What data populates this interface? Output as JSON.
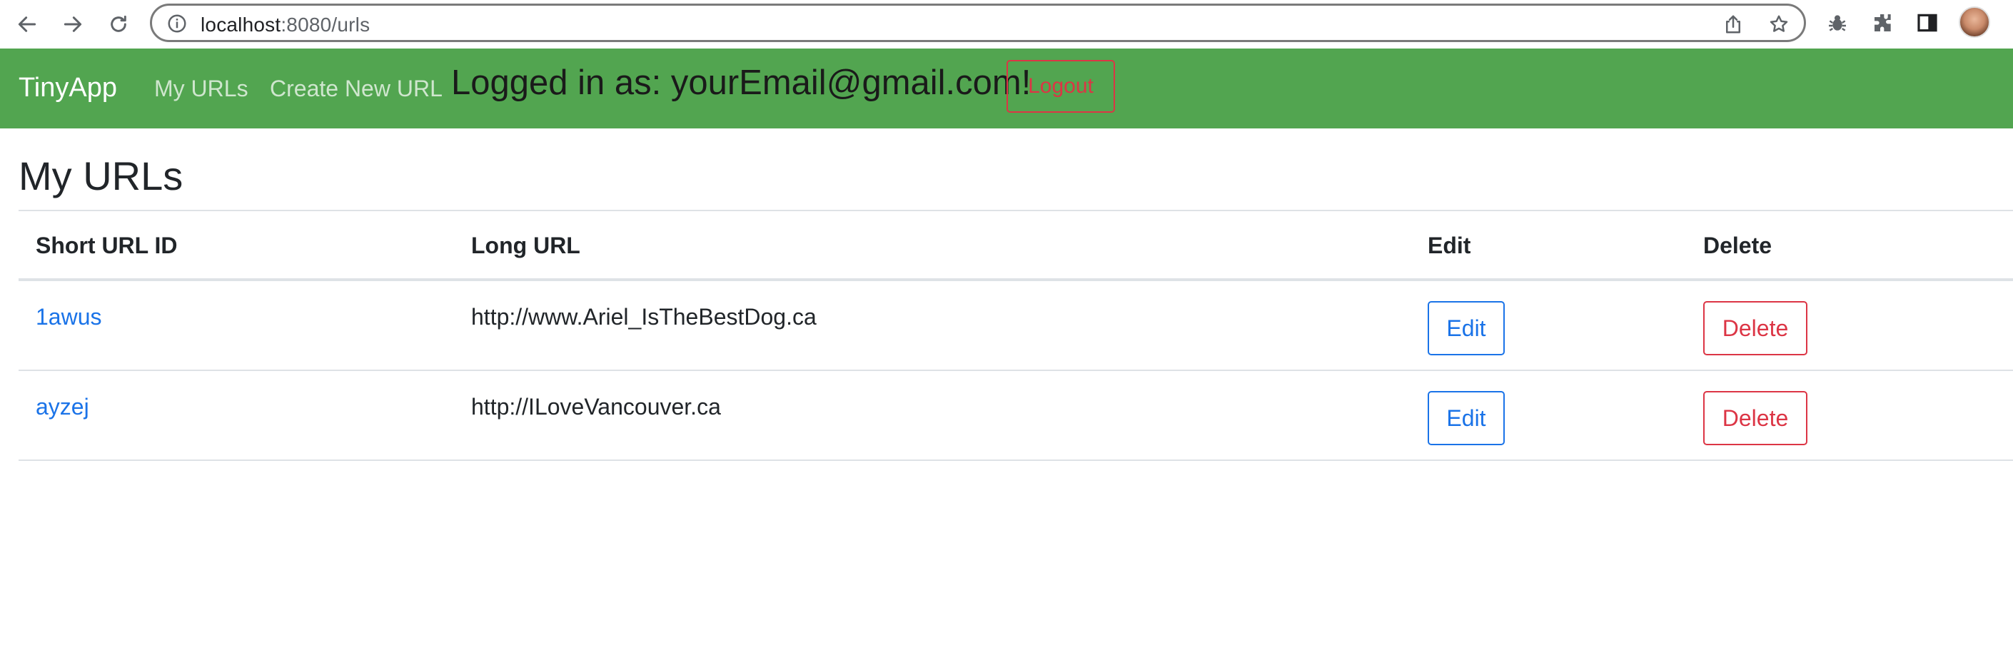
{
  "browser": {
    "url_host": "localhost",
    "url_path": ":8080/urls"
  },
  "navbar": {
    "brand": "TinyApp",
    "links": [
      {
        "label": "My URLs"
      },
      {
        "label": "Create New URL"
      }
    ],
    "logged_in_text": "Logged in as: yourEmail@gmail.com!",
    "logout_label": "Logout",
    "bg_color": "#52a550"
  },
  "main": {
    "title": "My URLs",
    "table": {
      "headers": [
        "Short URL ID",
        "Long URL",
        "Edit",
        "Delete"
      ],
      "rows": [
        {
          "short_id": "1awus",
          "long_url": "http://www.Ariel_IsTheBestDog.ca",
          "edit_label": "Edit",
          "delete_label": "Delete"
        },
        {
          "short_id": "ayzej",
          "long_url": "http://ILoveVancouver.ca",
          "edit_label": "Edit",
          "delete_label": "Delete"
        }
      ]
    }
  },
  "icons": [
    "back-icon",
    "forward-icon",
    "reload-icon",
    "info-icon",
    "share-icon",
    "star-icon",
    "bug-icon",
    "extensions-icon",
    "sidepanel-icon",
    "avatar"
  ]
}
